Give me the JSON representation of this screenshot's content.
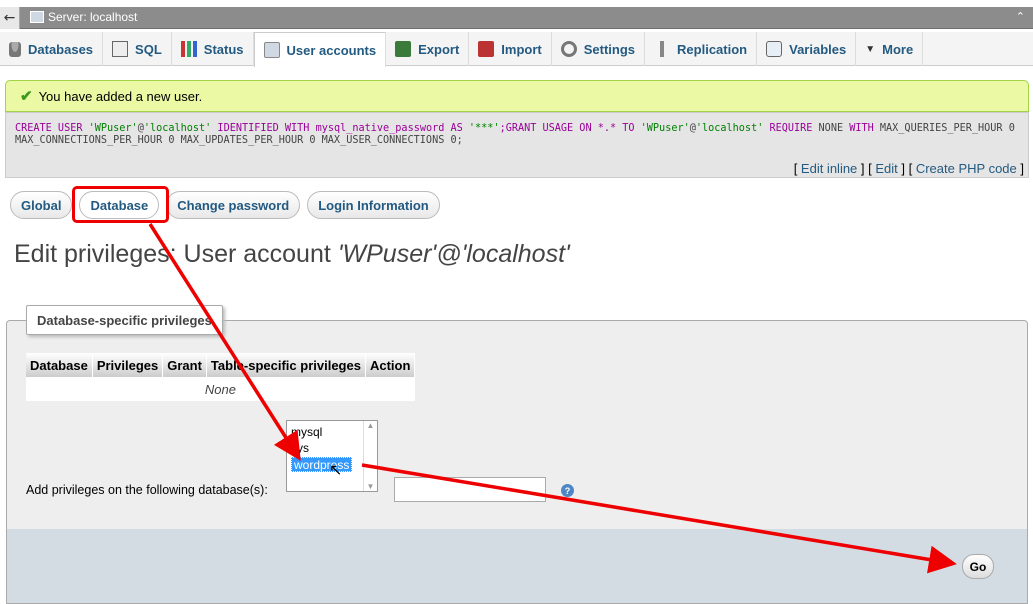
{
  "topbar": {
    "back_icon": "arrow-left-icon",
    "server_label": "Server: localhost"
  },
  "tabs": [
    {
      "label": "Databases",
      "icon": "database-icon"
    },
    {
      "label": "SQL",
      "icon": "sql-icon"
    },
    {
      "label": "Status",
      "icon": "status-icon"
    },
    {
      "label": "User accounts",
      "icon": "users-icon",
      "active": true
    },
    {
      "label": "Export",
      "icon": "export-icon"
    },
    {
      "label": "Import",
      "icon": "import-icon"
    },
    {
      "label": "Settings",
      "icon": "wrench-icon"
    },
    {
      "label": "Replication",
      "icon": "replication-icon"
    },
    {
      "label": "Variables",
      "icon": "variables-icon"
    },
    {
      "label": "More",
      "icon": "chevron-down-icon"
    }
  ],
  "notice": {
    "message": "You have added a new user."
  },
  "sql": {
    "parts": [
      {
        "t": "CREATE USER ",
        "c": "kw"
      },
      {
        "t": "'WPuser'",
        "c": "str"
      },
      {
        "t": "@",
        "c": ""
      },
      {
        "t": "'localhost'",
        "c": "str"
      },
      {
        "t": " IDENTIFIED WITH mysql_native_password AS ",
        "c": "kw"
      },
      {
        "t": "'***'",
        "c": "str"
      },
      {
        "t": ";GRANT USAGE ON *.* TO ",
        "c": "kw"
      },
      {
        "t": "'WPuser'",
        "c": "str"
      },
      {
        "t": "@",
        "c": ""
      },
      {
        "t": "'localhost'",
        "c": "str"
      },
      {
        "t": " REQUIRE ",
        "c": "kw"
      },
      {
        "t": "NONE ",
        "c": ""
      },
      {
        "t": "WITH",
        "c": "kw"
      },
      {
        "t": " MAX_QUERIES_PER_HOUR 0 MAX_CONNECTIONS_PER_HOUR 0 MAX_UPDATES_PER_HOUR 0 MAX_USER_CONNECTIONS 0;",
        "c": ""
      }
    ],
    "links": {
      "edit_inline": "Edit inline",
      "edit": "Edit",
      "create_php": "Create PHP code"
    }
  },
  "subtabs": [
    {
      "label": "Global"
    },
    {
      "label": "Database",
      "active": true
    },
    {
      "label": "Change password"
    },
    {
      "label": "Login Information"
    }
  ],
  "page": {
    "title_prefix": "Edit privileges: User account ",
    "title_account": "'WPuser'@'localhost'"
  },
  "privileges": {
    "legend": "Database-specific privileges",
    "columns": [
      "Database",
      "Privileges",
      "Grant",
      "Table-specific privileges",
      "Action"
    ],
    "empty_text": "None",
    "db_options": [
      "mysql",
      "sys",
      "wordpress"
    ],
    "selected_db": "wordpress",
    "add_label": "Add privileges on the following database(s):",
    "input_value": "",
    "go_label": "Go"
  },
  "colors": {
    "link": "#235a81",
    "annotation": "#e00000"
  }
}
